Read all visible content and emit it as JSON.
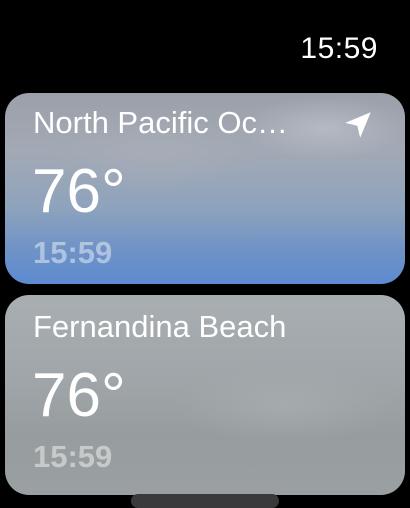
{
  "status_bar": {
    "time": "15:59"
  },
  "locations": [
    {
      "name": "North Pacific Oc…",
      "temperature": "76°",
      "local_time": "15:59",
      "icon": "location-arrow-icon"
    },
    {
      "name": "Fernandina Beach",
      "temperature": "76°",
      "local_time": "15:59"
    }
  ],
  "colors": {
    "background": "#000000",
    "text": "#ffffff",
    "time_dim": "rgba(255,255,255,0.45)"
  }
}
